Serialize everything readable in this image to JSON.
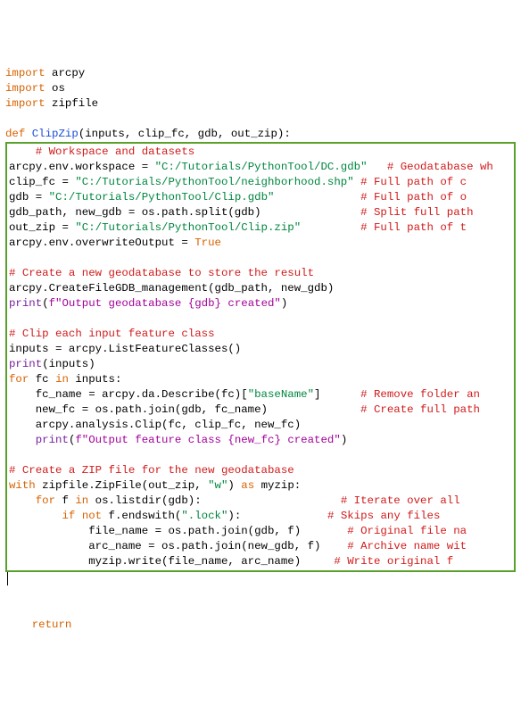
{
  "pre": {
    "l1a": "import",
    "l1b": " arcpy",
    "l2a": "import",
    "l2b": " os",
    "l3a": "import",
    "l3b": " zipfile",
    "l5a": "def",
    "l5b": " ",
    "l5c": "ClipZip",
    "l5d": "(inputs, clip_fc, gdb, out_zip):"
  },
  "box": {
    "l1": "    ",
    "l1c": "# Workspace and datasets",
    "l2a": "arcpy.env.workspace = ",
    "l2s": "\"C:/Tutorials/PythonTool/DC.gdb\"",
    "l2p": "   ",
    "l2c": "# Geodatabase wh",
    "l3a": "clip_fc = ",
    "l3s": "\"C:/Tutorials/PythonTool/neighborhood.shp\"",
    "l3p": " ",
    "l3c": "# Full path of c",
    "l4a": "gdb = ",
    "l4s": "\"C:/Tutorials/PythonTool/Clip.gdb\"",
    "l4p": "             ",
    "l4c": "# Full path of o",
    "l5a": "gdb_path, new_gdb = os.path.split(gdb)",
    "l5p": "               ",
    "l5c": "# Split full path",
    "l6a": "out_zip = ",
    "l6s": "\"C:/Tutorials/PythonTool/Clip.zip\"",
    "l6p": "         ",
    "l6c": "# Full path of t",
    "l7a": "arcpy.env.overwriteOutput = ",
    "l7b": "True",
    "l9c": "# Create a new geodatabase to store the result",
    "l10": "arcpy.CreateFileGDB_management(gdb_path, new_gdb)",
    "l11a": "print",
    "l11b": "(",
    "l11c": "f\"Output geodatabase {gdb} created\"",
    "l11d": ")",
    "l13c": "# Clip each input feature class",
    "l14": "inputs = arcpy.ListFeatureClasses()",
    "l15a": "print",
    "l15b": "(inputs)",
    "l16a": "for",
    "l16b": " fc ",
    "l16c": "in",
    "l16d": " inputs:",
    "l17a": "    fc_name = arcpy.da.Describe(fc)[",
    "l17s": "\"baseName\"",
    "l17b": "]",
    "l17p": "      ",
    "l17c": "# Remove folder an",
    "l18a": "    new_fc = os.path.join(gdb, fc_name)",
    "l18p": "              ",
    "l18c": "# Create full path",
    "l19": "    arcpy.analysis.Clip(fc, clip_fc, new_fc)",
    "l20a": "    ",
    "l20b": "print",
    "l20c": "(",
    "l20d": "f\"Output feature class {new_fc} created\"",
    "l20e": ")",
    "l22c": "# Create a ZIP file for the new geodatabase",
    "l23a": "with",
    "l23b": " zipfile.ZipFile(out_zip, ",
    "l23s": "\"w\"",
    "l23c": ") ",
    "l23d": "as",
    "l23e": " myzip:",
    "l24a": "    ",
    "l24b": "for",
    "l24c": " f ",
    "l24d": "in",
    "l24e": " os.listdir(gdb):",
    "l24p": "                     ",
    "l24cm": "# Iterate over all",
    "l25a": "        ",
    "l25b": "if",
    "l25c": " ",
    "l25d": "not",
    "l25e": " f.endswith(",
    "l25s": "\".lock\"",
    "l25f": "):",
    "l25p": "             ",
    "l25cm": "# Skips any files",
    "l26a": "            file_name = os.path.join(gdb, f)",
    "l26p": "       ",
    "l26cm": "# Original file na",
    "l27a": "            arc_name = os.path.join(new_gdb, f)",
    "l27p": "    ",
    "l27cm": "# Archive name wit",
    "l28a": "            myzip.write(file_name, arc_name)",
    "l28p": "     ",
    "l28cm": "# Write original f"
  },
  "post": {
    "ret": "    ",
    "retk": "return"
  }
}
